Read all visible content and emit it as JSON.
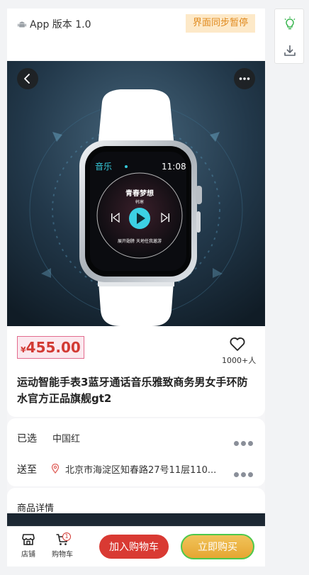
{
  "header": {
    "app_version": "App 版本 1.0",
    "sync_status": "界面同步暂停"
  },
  "product": {
    "currency_symbol": "¥",
    "price": "455.00",
    "favorite_count": "1000+人",
    "title": "运动智能手表3蓝牙通话音乐雅致商务男女手环防水官方正品旗舰gt2",
    "watch_screen": {
      "app_name": "音乐",
      "time": "11:08",
      "song_title": "青春梦想",
      "artist": "韩寒",
      "lyric": "展开翅膀 天地任我遨游"
    }
  },
  "specs": {
    "selected_label": "已选",
    "selected_value": "中国红",
    "delivery_label": "送至",
    "delivery_address": "北京市海淀区知春路27号11层110..."
  },
  "details": {
    "title": "商品详情"
  },
  "bottom_bar": {
    "store_label": "店铺",
    "cart_label": "购物车",
    "cart_count": "1",
    "add_to_cart": "加入购物车",
    "buy_now": "立即购买"
  },
  "colors": {
    "price_red": "#d23a34",
    "add_cart_red": "#d93a33",
    "buy_now_gold": "#e6a632",
    "sync_badge_bg": "#fde9c8",
    "accent_green": "#4cc94c"
  }
}
